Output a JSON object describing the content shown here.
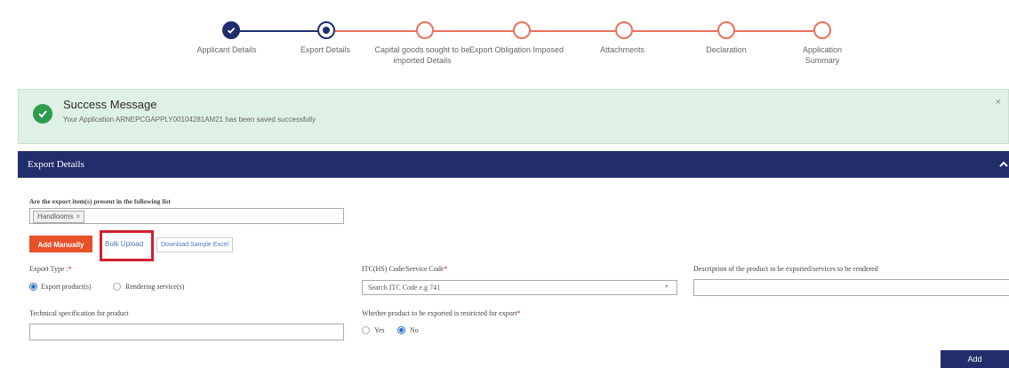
{
  "stepper": {
    "steps": [
      {
        "label": "Applicant Details",
        "state": "done"
      },
      {
        "label": "Export Details",
        "state": "current"
      },
      {
        "label": "Capital goods sought to be imported Details",
        "state": "pending"
      },
      {
        "label": "Export Obligation Imposed",
        "state": "pending"
      },
      {
        "label": "Attachments",
        "state": "pending"
      },
      {
        "label": "Declaration",
        "state": "pending"
      },
      {
        "label": "Application Summary",
        "state": "pending"
      }
    ],
    "colors": {
      "done": "#1e2e6e",
      "pending": "#e8725f"
    }
  },
  "alert": {
    "title": "Success Message",
    "text": "Your Application ARNEPCGAPPLY00104281AM21 has been saved successfully",
    "close": "×",
    "icon": "check-circle-icon"
  },
  "section": {
    "title": "Export Details",
    "icon": "chevron-up-icon",
    "color": "#222d6b"
  },
  "form": {
    "list_question": "Are the export item(s) present in the following list",
    "selected_chip": "Handlooms",
    "chip_remove": "×",
    "add_manually": "Add Manually",
    "bulk_upload": "Bulk Upload",
    "download_sample": "Download Sample Excel",
    "export_type_label": "Export Type :",
    "export_type_options": [
      {
        "label": "Export product(s)",
        "selected": true
      },
      {
        "label": "Rendering service(s)",
        "selected": false
      }
    ],
    "itc_label": "ITC(HS) Code/Service Code",
    "itc_placeholder": "Search ITC Code e.g 741",
    "description_label": "Description of the product to be exported/services to be rendered",
    "tech_spec_label": "Technical specification for product",
    "restricted_label": "Whether product to be exported is restricted for export",
    "restricted_options": [
      {
        "label": "Yes",
        "selected": false
      },
      {
        "label": "No",
        "selected": true
      }
    ],
    "required_mark": "*",
    "next_button": "Add"
  }
}
